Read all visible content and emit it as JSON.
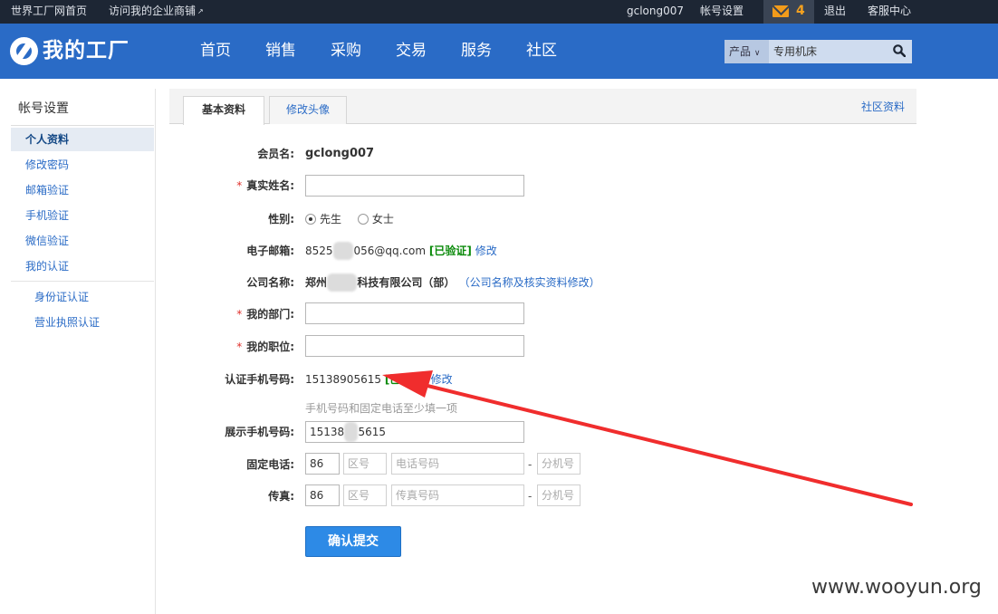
{
  "topbar": {
    "home_link": "世界工厂网首页",
    "shop_link": "访问我的企业商铺",
    "username": "gclong007",
    "account_settings": "帐号设置",
    "mail_count": "4",
    "logout": "退出",
    "service": "客服中心"
  },
  "header": {
    "logo_text": "我的工厂",
    "nav": [
      "首页",
      "销售",
      "采购",
      "交易",
      "服务",
      "社区"
    ],
    "search_category": "产品",
    "search_value": "专用机床"
  },
  "sidebar": {
    "title": "帐号设置",
    "items": [
      "个人资料",
      "修改密码",
      "邮箱验证",
      "手机验证",
      "微信验证",
      "我的认证"
    ],
    "sub_items": [
      "身份证认证",
      "营业执照认证"
    ]
  },
  "tabs": {
    "basic": "基本资料",
    "avatar": "修改头像",
    "community": "社区资料"
  },
  "form": {
    "member_label": "会员名:",
    "member_value": "gclong007",
    "realname_label": "真实姓名:",
    "gender_label": "性别:",
    "gender_male": "先生",
    "gender_female": "女士",
    "email_label": "电子邮箱:",
    "email_prefix": "8525",
    "email_hidden": "000",
    "email_suffix": "056@qq.com",
    "email_verified": "[已验证]",
    "email_edit": "修改",
    "company_label": "公司名称:",
    "company_prefix": "郑州",
    "company_hidden": "0000",
    "company_suffix": "科技有限公司（部）",
    "company_edit": "（公司名称及核实资料修改）",
    "dept_label": "我的部门:",
    "position_label": "我的职位:",
    "auth_phone_label": "认证手机号码:",
    "auth_phone_value": "15138905615",
    "auth_phone_verified": "[已验证]",
    "auth_phone_edit": "修改",
    "hint": "手机号码和固定电话至少填一项",
    "display_phone_label": "展示手机号码:",
    "display_phone_prefix": "15138",
    "display_phone_hidden": "00",
    "display_phone_suffix": "5615",
    "tel_label": "固定电话:",
    "fax_label": "传真:",
    "country_code": "86",
    "area_placeholder": "区号",
    "tel_placeholder": "电话号码",
    "fax_placeholder": "传真号码",
    "ext_placeholder": "分机号",
    "dash": "-",
    "submit": "确认提交"
  },
  "watermark": "www.wooyun.org",
  "colors": {
    "topbar": "#1d2634",
    "header": "#2a6bc6",
    "arrow": "#f02d2d",
    "verified": "#0a8a0a"
  }
}
